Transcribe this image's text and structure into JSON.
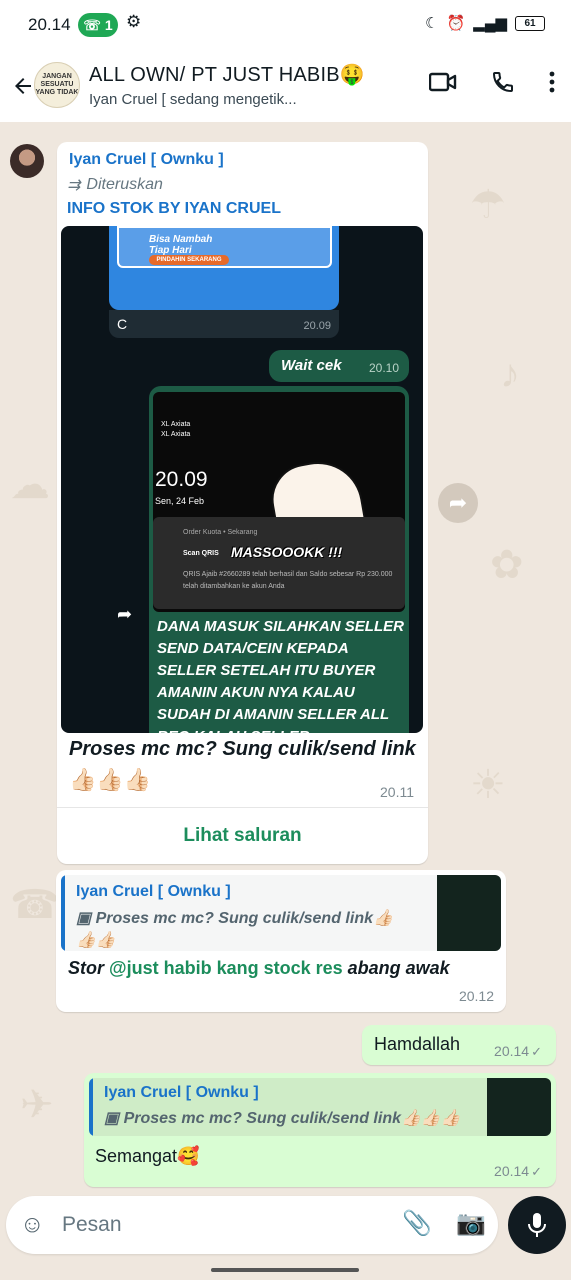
{
  "status_bar": {
    "time": "20.14",
    "call_count": "1",
    "battery": "61"
  },
  "header": {
    "title": "ALL OWN/ PT JUST HABIB🤑",
    "subtitle": "Iyan Cruel [ sedang mengetik...",
    "avatar_text": "JANGAN SESUATU YANG TIDAK"
  },
  "forwarded_message": {
    "sender": "Iyan Cruel [ Ownku ]",
    "forwarded_label": "Diteruskan",
    "heading": "INFO STOK BY IYAN CRUEL",
    "image": {
      "banner_line1": "Bisa Nambah",
      "banner_line2": "Tiap Hari",
      "banner_button": "PINDAHIN SEKARANG",
      "inner_letter": "C",
      "inner_letter_time": "20.09",
      "wait_text": "Wait cek",
      "wait_time": "20.10",
      "carrier1": "XL Axiata",
      "carrier2": "XL Axiata",
      "lock_time": "20.09",
      "lock_date": "Sen, 24 Feb",
      "notif_app": "Order Kuota • Sekarang",
      "notif_title": "Scan QRIS",
      "notif_body": "QRIS Ajaib #2660289 telah berhasil dan Saldo sebesar Rp 230.000 telah ditambahkan ke akun Anda",
      "overlay_text": "MASSOOOKK !!!",
      "body_text": "DANA MASUK SILAHKAN SELLER SEND DATA/CEIN KEPADA SELLER SETELAH ITU BUYER AMANIN AKUN NYA KALAU SUDAH DI AMANIN SELLER ALL REG KALAU SELLER"
    },
    "caption": "Proses mc mc? Sung culik/send link",
    "caption_emojis": "👍🏻👍🏻👍🏻",
    "time": "20.11",
    "channel_link": "Lihat saluran"
  },
  "reply_message": {
    "quote_name": "Iyan Cruel [ Ownku ]",
    "quote_text": "Proses mc mc? Sung culik/send link👍🏻👍🏻👍🏻",
    "text_prefix": "Stor ",
    "mention": "@just habib kang stock res",
    "text_suffix": " abang awak",
    "time": "20.12"
  },
  "outgoing_1": {
    "text": "Hamdallah",
    "time": "20.14"
  },
  "outgoing_2": {
    "quote_name": "Iyan Cruel [ Ownku ]",
    "quote_text": "Proses mc mc? Sung culik/send link👍🏻👍🏻👍🏻",
    "text": "Semangat🥰",
    "time": "20.14"
  },
  "input": {
    "placeholder": "Pesan"
  },
  "colors": {
    "accent_green": "#1c8d5c",
    "sender_blue": "#1a73c9",
    "outgoing_bubble": "#d9fdd3",
    "chat_bg": "#efe7de"
  }
}
